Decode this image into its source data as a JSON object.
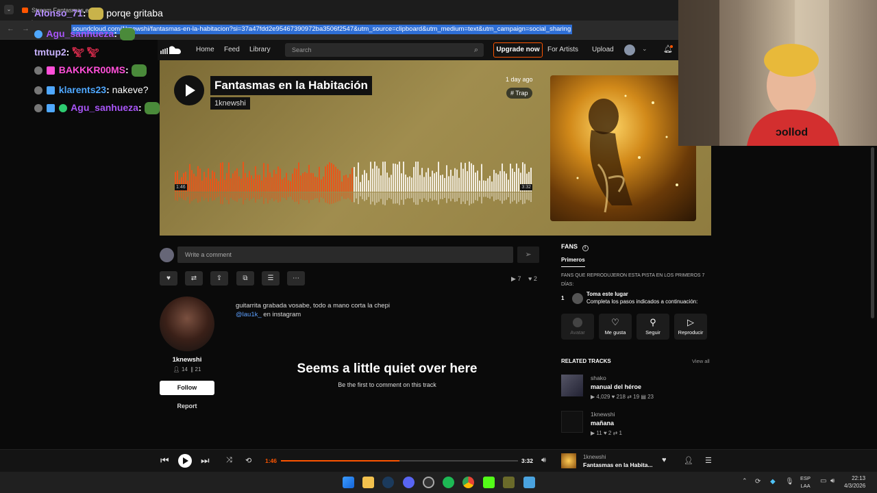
{
  "browser": {
    "tab_title": "Stream Fantasmas en l",
    "url": "soundcloud.com/1knewshi/fantasmas-en-la-habitacion?si=37a47fdd2e95467390972ba3506f2547&utm_source=clipboard&utm_medium=text&utm_campaign=social_sharing"
  },
  "chat": [
    {
      "user": "Alonso_71",
      "color": "#b58cff",
      "message": "porqe gritaba"
    },
    {
      "user": "Agu_sanhueza",
      "color": "#a855f7",
      "message": ""
    },
    {
      "user": "tmtup2",
      "color": "#c9b3ff",
      "message": ""
    },
    {
      "user": "BAKKKR00MS",
      "color": "#ff4fd8",
      "message": ""
    },
    {
      "user": "klarents23",
      "color": "#4fa8ff",
      "message": "nakeve?"
    },
    {
      "user": "Agu_sanhueza",
      "color": "#a855f7",
      "message": ""
    }
  ],
  "sc_nav": {
    "home": "Home",
    "feed": "Feed",
    "library": "Library",
    "search_placeholder": "Search",
    "upgrade": "Upgrade now",
    "for_artists": "For Artists",
    "upload": "Upload"
  },
  "track": {
    "title": "Fantasmas en la Habitación",
    "artist": "1knewshi",
    "posted": "1 day ago",
    "tag": "# Trap",
    "elapsed": "1:46",
    "duration": "3:32",
    "progress": 0.5
  },
  "comment": {
    "placeholder": "Write a comment"
  },
  "stats": {
    "plays": "7",
    "likes": "2"
  },
  "uploader": {
    "name": "1knewshi",
    "followers": "14",
    "tracks": "21",
    "follow": "Follow",
    "report": "Report"
  },
  "description": {
    "line1": "guitarrita grabada vosabe, todo a mano corta la chepi",
    "mention": "@lau1k_",
    "line2_rest": " en instagram"
  },
  "empty_comments": {
    "title": "Seems a little quiet over here",
    "subtitle": "Be the first to comment on this track"
  },
  "fans": {
    "title": "FANS",
    "tab": "Primeros",
    "note": "FANS QUE REPRODUJERON ESTA PISTA EN LOS PRIMEROS 7 DÍAS:",
    "rank": "1",
    "rank_title": "Toma este lugar",
    "rank_sub": "Completa los pasos indicados a continuación:",
    "buttons": [
      "Avatar",
      "Me gusta",
      "Seguir",
      "Reproducir"
    ]
  },
  "related": {
    "title": "RELATED TRACKS",
    "view_all": "View all",
    "tracks": [
      {
        "artist": "shako",
        "title": "manual del héroe",
        "plays": "4,029",
        "likes": "218",
        "reposts": "19",
        "comments": "23"
      },
      {
        "artist": "1knewshi",
        "title": "mañana",
        "plays": "11",
        "likes": "2",
        "reposts": "1",
        "comments": ""
      }
    ]
  },
  "player": {
    "artist": "1knewshi",
    "title": "Fantasmas en la Habita...",
    "elapsed": "1:46",
    "duration": "3:32"
  },
  "taskbar": {
    "lang1": "ESP",
    "lang2": "LAA",
    "time": "22:13",
    "date": "4/3/2026"
  },
  "colors": {
    "accent": "#ff5500",
    "hero_bg": "#8f7c3f"
  }
}
